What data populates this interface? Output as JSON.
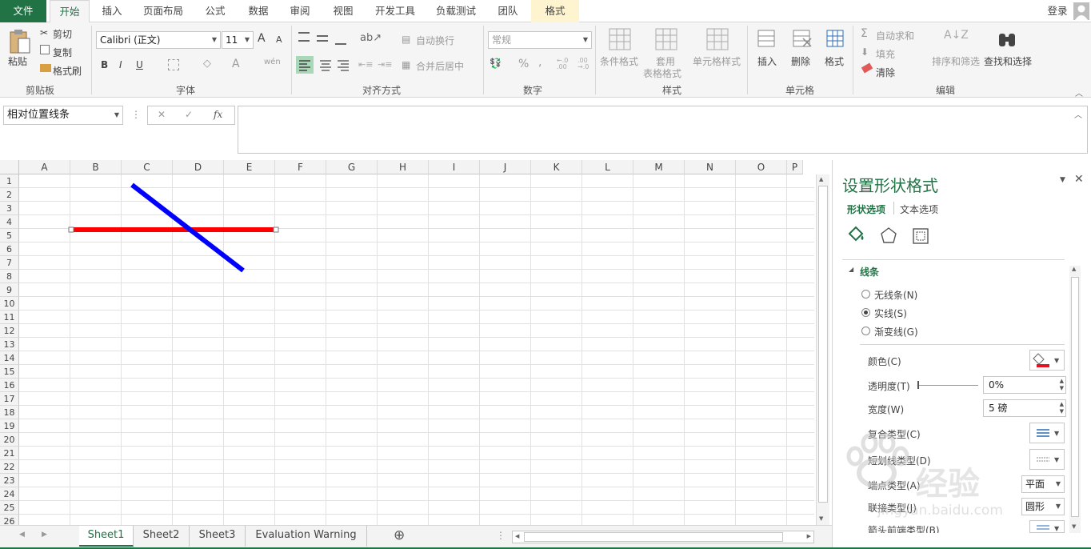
{
  "tabs": {
    "file": "文件",
    "home": "开始",
    "insert": "插入",
    "page_layout": "页面布局",
    "formulas": "公式",
    "data": "数据",
    "review": "审阅",
    "view": "视图",
    "developer": "开发工具",
    "load_test": "负载测试",
    "team": "团队",
    "format": "格式",
    "login": "登录"
  },
  "ribbon": {
    "clipboard": {
      "paste": "粘贴",
      "cut": "剪切",
      "copy": "复制",
      "format_painter": "格式刷",
      "label": "剪贴板"
    },
    "font": {
      "name": "Calibri (正文)",
      "size": "11",
      "bold": "B",
      "italic": "I",
      "underline": "U",
      "label": "字体",
      "grow": "A",
      "shrink": "A",
      "font_color": "A",
      "phonetic": "wén"
    },
    "alignment": {
      "wrap": "自动换行",
      "merge": "合并后居中",
      "label": "对齐方式"
    },
    "number": {
      "format": "常规",
      "percent": "%",
      "comma": ",",
      "inc_dec1": "←.0\n.00",
      "inc_dec2": ".00\n→.0",
      "label": "数字"
    },
    "styles": {
      "conditional": "条件格式",
      "table1": "套用",
      "table2": "表格格式",
      "cell": "单元格样式",
      "label": "样式"
    },
    "cells": {
      "insert": "插入",
      "delete": "删除",
      "format": "格式",
      "label": "单元格"
    },
    "editing": {
      "autosum": "自动求和",
      "fill": "填充",
      "clear": "清除",
      "sort": "排序和筛选",
      "find": "查找和选择",
      "label": "编辑"
    }
  },
  "formula_bar": {
    "name_box": "相对位置线条",
    "cancel": "✕",
    "enter": "✓",
    "fx": "fx",
    "formula": ""
  },
  "grid": {
    "columns": [
      "A",
      "B",
      "C",
      "D",
      "E",
      "F",
      "G",
      "H",
      "I",
      "J",
      "K",
      "L",
      "M",
      "N",
      "O",
      "P"
    ],
    "rows": [
      "1",
      "2",
      "3",
      "4",
      "5",
      "6",
      "7",
      "8",
      "9",
      "10",
      "11",
      "12",
      "13",
      "14",
      "15",
      "16",
      "17",
      "18",
      "19",
      "20",
      "21",
      "22",
      "23",
      "24",
      "25",
      "26"
    ]
  },
  "shapes": {
    "red_line_color": "#ff0000",
    "blue_line_color": "#0000ff"
  },
  "sheets": {
    "tabs": [
      "Sheet1",
      "Sheet2",
      "Sheet3",
      "Evaluation Warning"
    ],
    "active": "Sheet1",
    "add": "⊕"
  },
  "pane": {
    "title": "设置形状格式",
    "tab_shape": "形状选项",
    "tab_text": "文本选项",
    "section": "线条",
    "no_line": "无线条(N)",
    "solid_line": "实线(S)",
    "gradient_line": "渐变线(G)",
    "color": "颜色(C)",
    "transparency": "透明度(T)",
    "transparency_value": "0%",
    "width": "宽度(W)",
    "width_value": "5 磅",
    "compound": "复合类型(C)",
    "dash": "短划线类型(D)",
    "cap": "端点类型(A)",
    "cap_value": "平面",
    "join": "联接类型(J)",
    "join_value": "圆形",
    "arrow_begin": "箭头前端类型(B)",
    "accent_color": "#217346"
  },
  "watermark": {
    "text": "经验",
    "url": "jingyan.baidu.com"
  }
}
